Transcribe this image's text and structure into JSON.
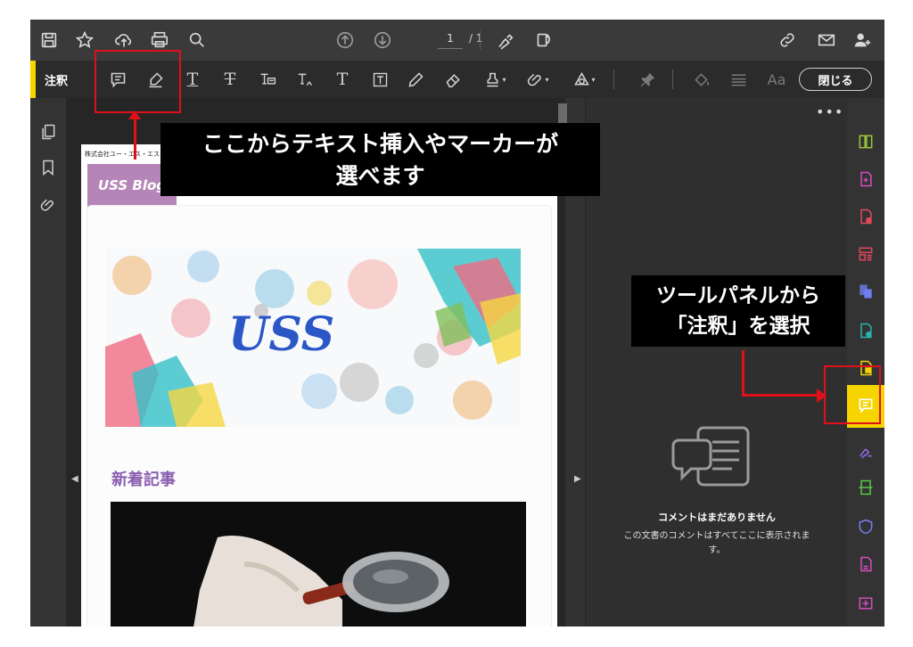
{
  "topbar": {
    "page_current": "1",
    "page_total": "/ 1",
    "icons_left": [
      "save-icon",
      "star-icon",
      "cloud-upload-icon",
      "print-icon",
      "zoom-search-icon"
    ],
    "icons_center": [
      "page-up-icon",
      "page-down-icon"
    ],
    "icons_right": [
      "sign-icon",
      "share-link-icon",
      "email-icon",
      "add-user-icon"
    ]
  },
  "annotation_bar": {
    "label": "注釈",
    "close_label": "閉じる",
    "font_label": "Aa",
    "text_tool_glyphs": [
      "T",
      "T",
      "T",
      "T",
      "T"
    ]
  },
  "document": {
    "header_text": "株式会社ユー・エス・エス",
    "logo_text": "USS Blog",
    "banner_logo": "USS",
    "section_title": "新着記事"
  },
  "comments_panel": {
    "more_label": "•••",
    "empty_title": "コメントはまだありません",
    "empty_desc": "この文書のコメントはすべてここに表示されます。"
  },
  "callouts": {
    "top_line1": "ここからテキスト挿入やマーカーが",
    "top_line2": "選べます",
    "right_line1": "ツールパネルから",
    "right_line2": "「注釈」を選択"
  },
  "colors": {
    "accent_yellow": "#f5d400",
    "highlight_red": "#e0101a",
    "app_bg": "#323232",
    "section_purple": "#8b5fb0"
  },
  "tool_rail_icons": [
    "compare-icon",
    "create-pdf-icon",
    "export-pdf-icon",
    "organize-pages-icon",
    "combine-files-icon",
    "edit-pdf-icon",
    "export-icon",
    "comment-icon",
    "fill-sign-icon",
    "scan-icon",
    "protect-icon",
    "pdf-icon",
    "redact-icon",
    "more-tools-icon"
  ]
}
